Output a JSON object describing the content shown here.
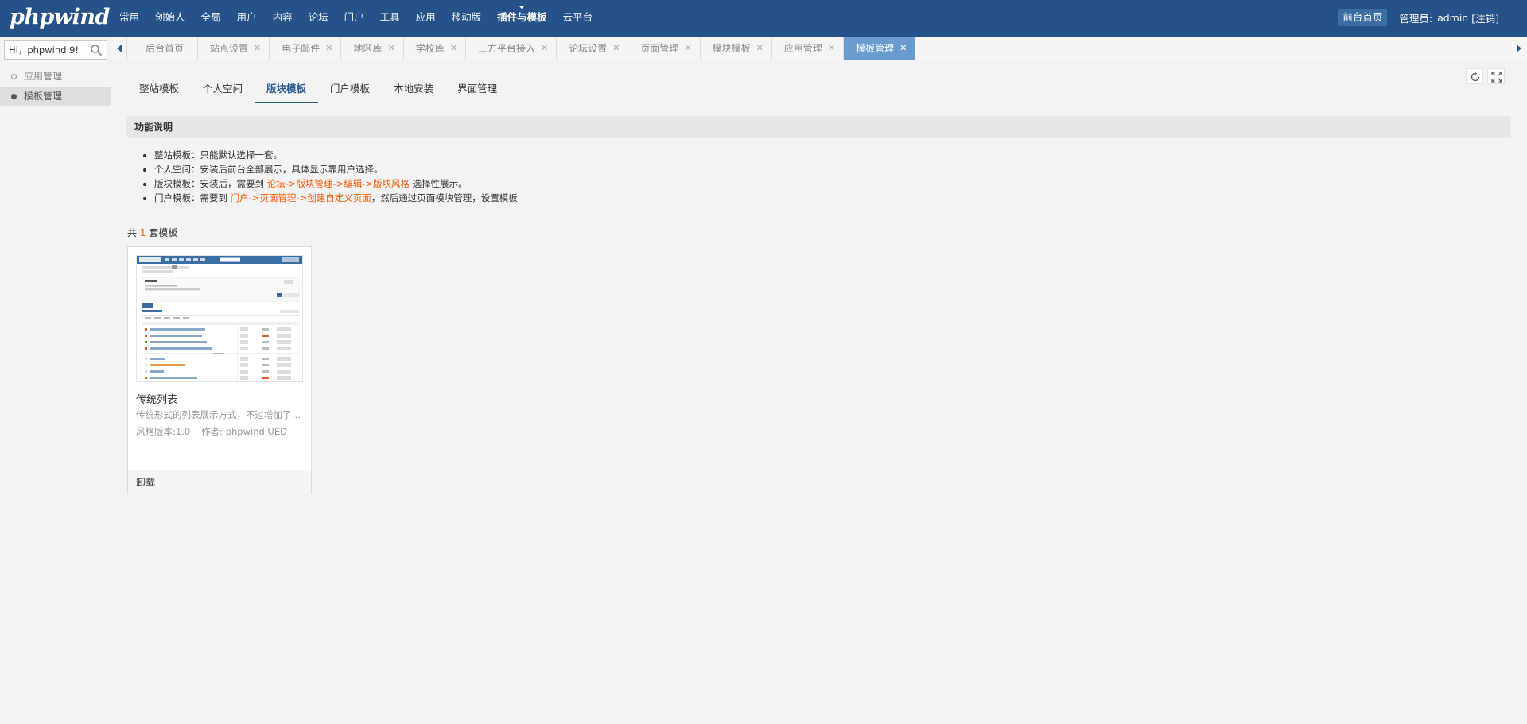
{
  "logo": "phpwind",
  "topnav": [
    "常用",
    "创始人",
    "全局",
    "用户",
    "内容",
    "论坛",
    "门户",
    "工具",
    "应用",
    "移动版",
    "插件与模板",
    "云平台"
  ],
  "topnav_active": 10,
  "topright": {
    "front_label": "前台首页",
    "admin_label": "管理员:",
    "admin_name": "admin",
    "logout_label": "[注销]"
  },
  "search": {
    "value": "Hi，phpwind 9!"
  },
  "sidebar": [
    {
      "label": "应用管理",
      "active": false
    },
    {
      "label": "模板管理",
      "active": true
    }
  ],
  "tabs": [
    {
      "label": "后台首页",
      "closable": false
    },
    {
      "label": "站点设置",
      "closable": true
    },
    {
      "label": "电子邮件",
      "closable": true
    },
    {
      "label": "地区库",
      "closable": true
    },
    {
      "label": "学校库",
      "closable": true
    },
    {
      "label": "三方平台接入",
      "closable": true
    },
    {
      "label": "论坛设置",
      "closable": true
    },
    {
      "label": "页面管理",
      "closable": true
    },
    {
      "label": "模块模板",
      "closable": true
    },
    {
      "label": "应用管理",
      "closable": true
    },
    {
      "label": "模板管理",
      "closable": true,
      "active": true
    }
  ],
  "subtabs": [
    "整站模板",
    "个人空间",
    "版块模板",
    "门户模板",
    "本地安装",
    "界面管理"
  ],
  "subtab_active": 2,
  "description": {
    "title": "功能说明",
    "items": [
      {
        "text": "整站模板：只能默认选择一套。"
      },
      {
        "text": "个人空间：安装后前台全部展示，具体显示靠用户选择。"
      },
      {
        "prefix": "版块模板：安装后，需要到 ",
        "highlight": "论坛->版块管理->编辑->版块风格",
        "suffix": " 选择性展示。"
      },
      {
        "prefix": "门户模板：需要到 ",
        "highlight": "门户->页面管理->创建自定义页面",
        "suffix": "，然后通过页面模块管理，设置模板"
      }
    ]
  },
  "count": {
    "prefix": "共 ",
    "num": "1",
    "suffix": " 套模板"
  },
  "template": {
    "name": "传统列表",
    "desc": "传统形式的列表展示方式，不过增加了用户头像及其他信息",
    "version": "风格版本:1.0",
    "author": "作者:  phpwind UED",
    "uninstall": "卸载"
  },
  "colors": {
    "topbar": "#255389",
    "accent": "#2a5a92",
    "highlight": "#ff5500",
    "active_tab": "#6a9cd0"
  }
}
